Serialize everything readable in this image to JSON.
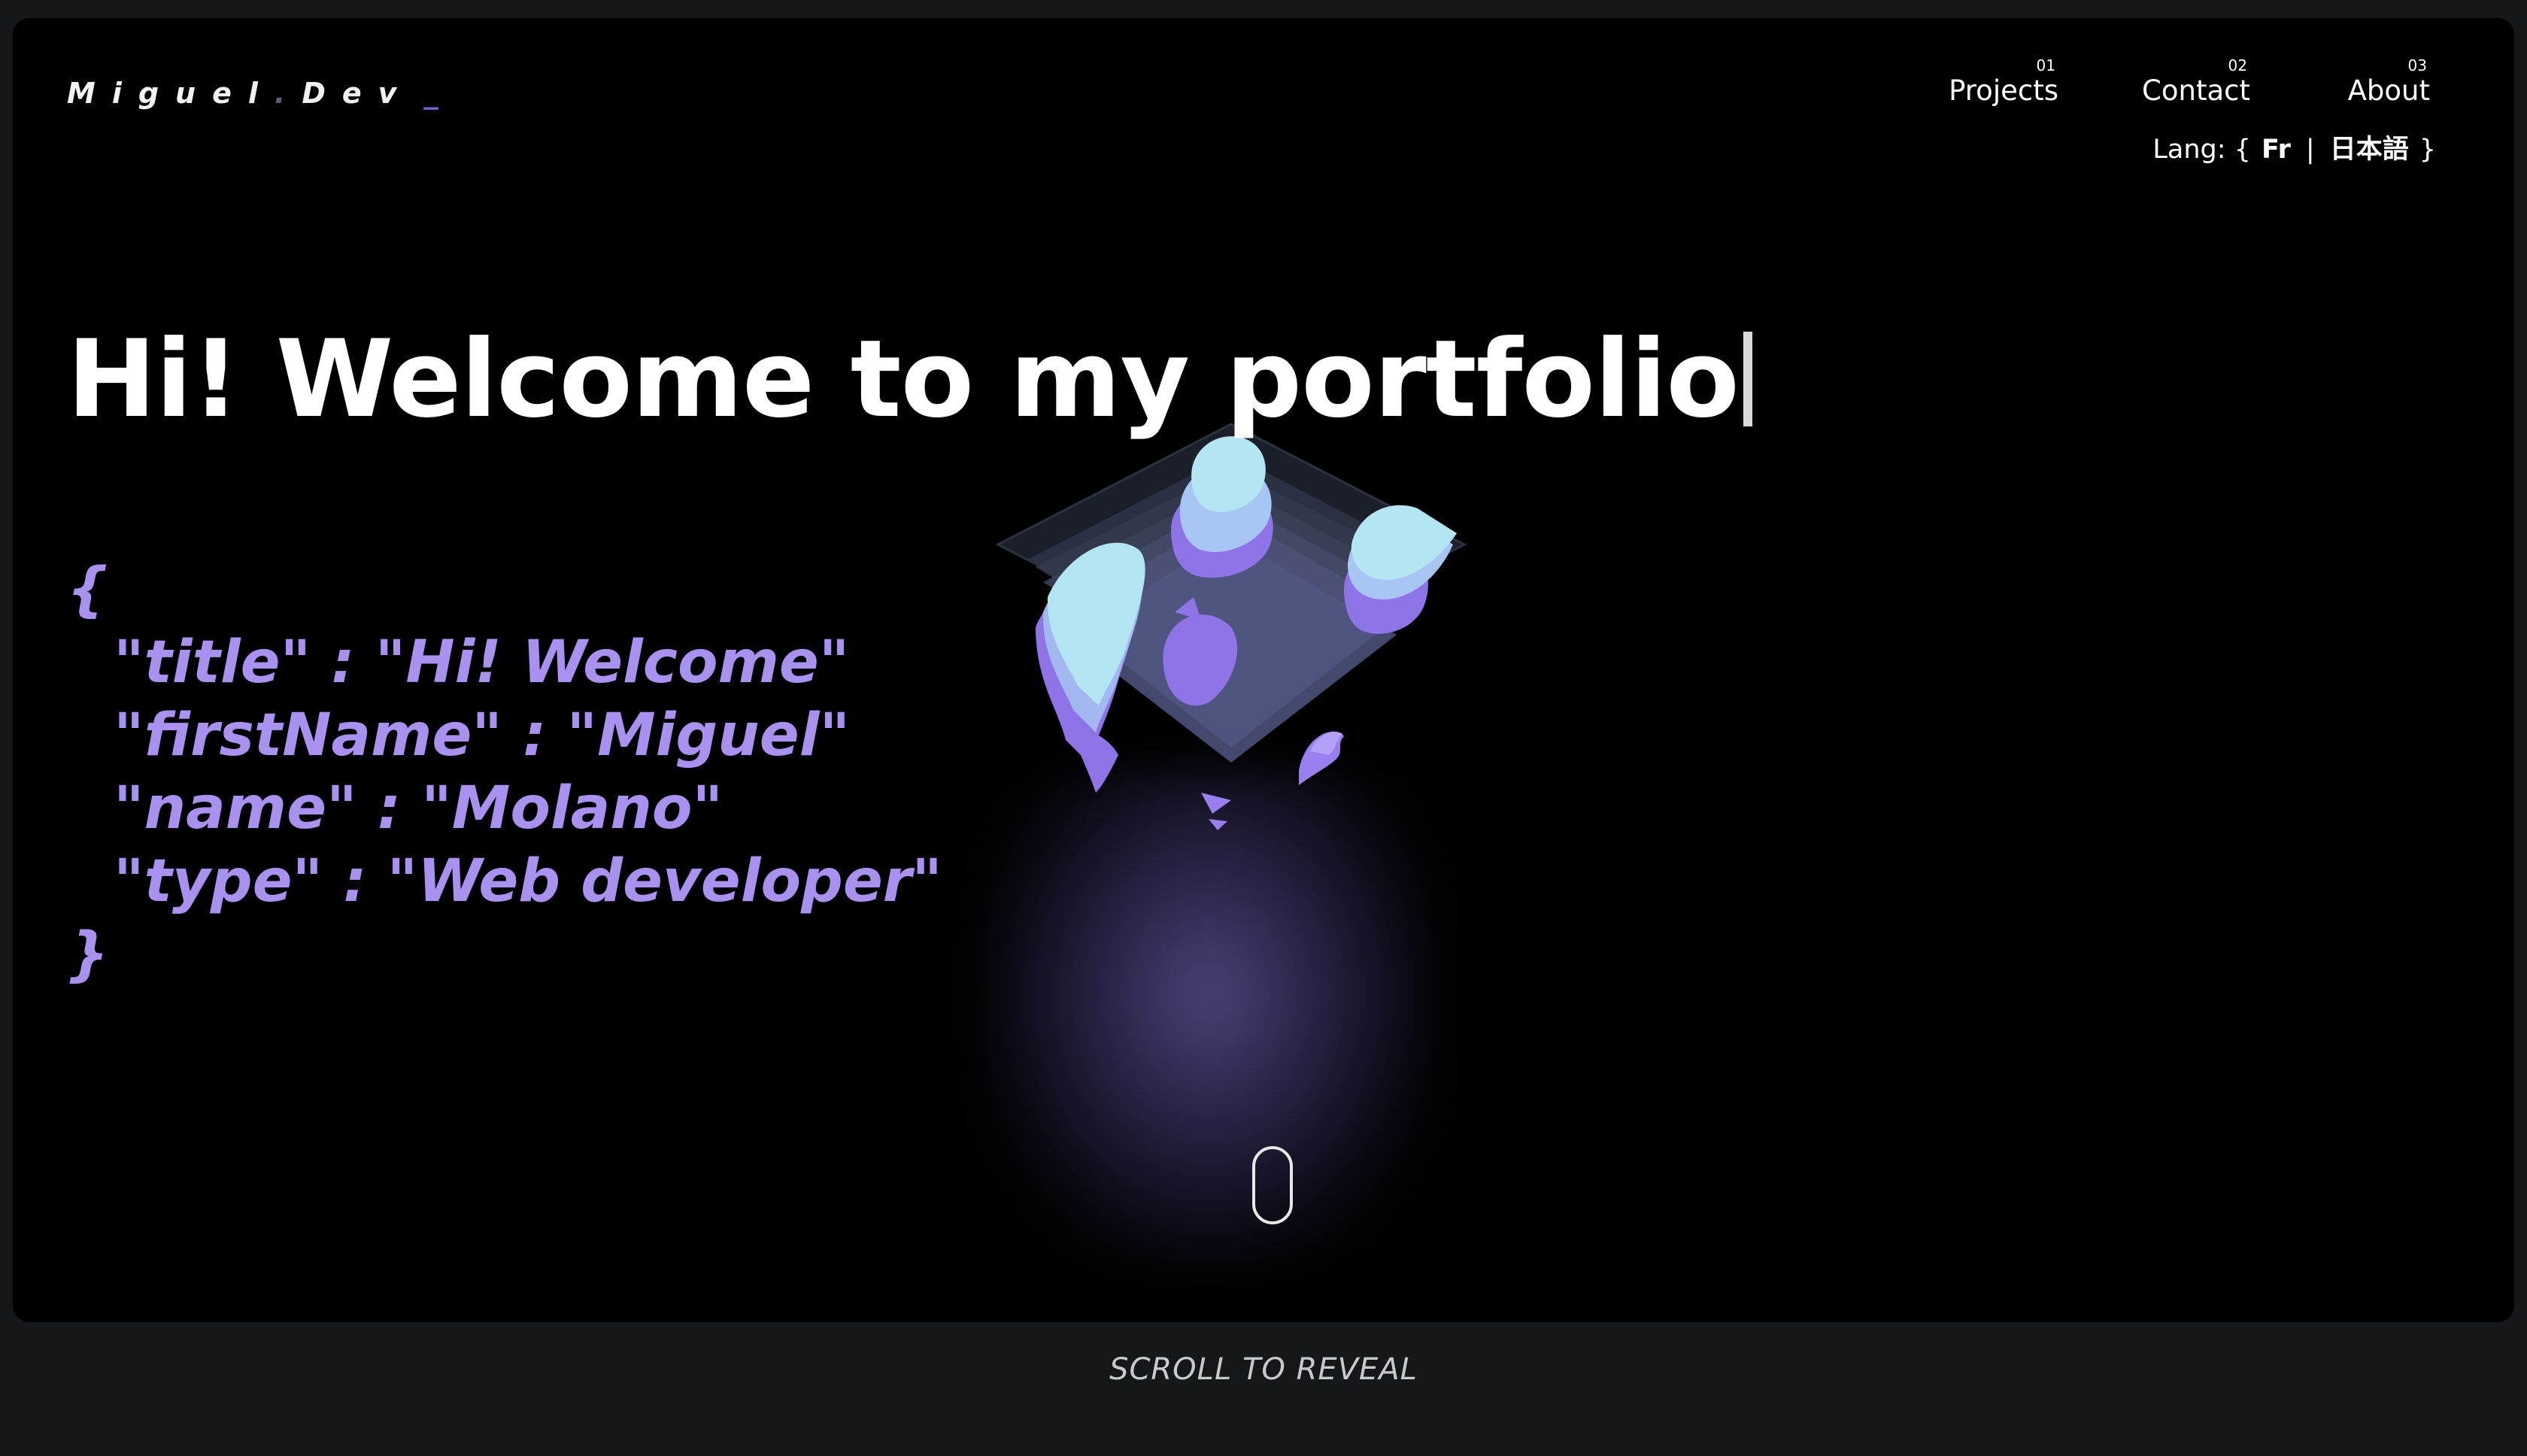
{
  "header": {
    "logo": {
      "part1": "Miguel",
      "dot": ".",
      "part2": "Dev",
      "cursor": "_"
    },
    "nav": [
      {
        "num": "01",
        "label": "Projects"
      },
      {
        "num": "02",
        "label": "Contact"
      },
      {
        "num": "03",
        "label": "About"
      }
    ],
    "lang": {
      "prefix": "Lang: {",
      "options": [
        "Fr",
        "日本語"
      ],
      "separator": "|",
      "suffix": "}"
    }
  },
  "hero": {
    "headline": "Hi! Welcome to my portfolio",
    "json_block": {
      "open": "{",
      "lines": [
        "\"title\" : \"Hi! Welcome\"",
        "\"firstName\" : \"Miguel\"",
        "\"name\" : \"Molano\"",
        "\"type\" : \"Web developer\""
      ],
      "close": "}"
    }
  },
  "footer": {
    "scroll_hint": "SCROLL TO REVEAL"
  },
  "icons": {
    "mouse": "scroll-mouse-icon",
    "cube": "isometric-cube-graphic"
  },
  "colors": {
    "background": "#000000",
    "page_background": "#14181b",
    "accent_purple": "#a991f0",
    "cube_cyan": "#b3e6f2",
    "text": "#ffffff"
  }
}
